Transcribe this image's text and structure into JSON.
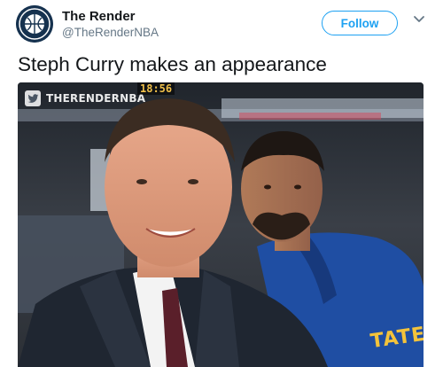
{
  "account": {
    "display_name": "The Render",
    "handle": "@TheRenderNBA",
    "avatar_icon": "basketball-logo-icon"
  },
  "actions": {
    "follow_label": "Follow",
    "menu_icon": "chevron-down-icon"
  },
  "tweet": {
    "text": "Steph Curry makes an appearance"
  },
  "media": {
    "watermark_icon": "twitter-bird-icon",
    "watermark_text": "THERENDERNBA",
    "scoreboard_time": "18:56",
    "jersey_text": "TATE"
  },
  "colors": {
    "brand_blue": "#1da1f2",
    "text_primary": "#14171a",
    "text_secondary": "#657786",
    "jersey_gold": "#f3c33b",
    "jersey_blue": "#1f4ea3"
  }
}
